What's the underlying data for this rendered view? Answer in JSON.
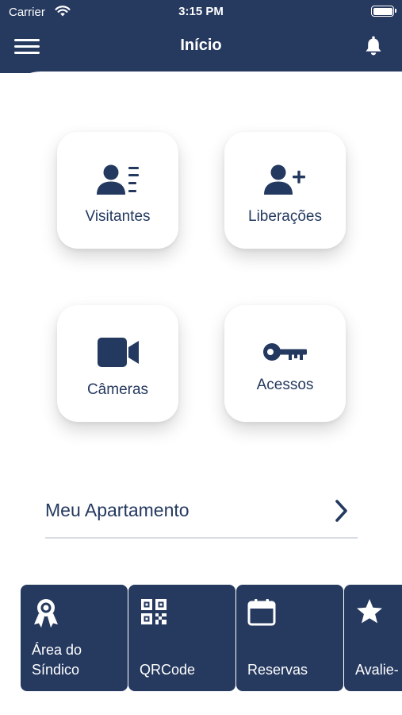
{
  "status_bar": {
    "carrier": "Carrier",
    "time": "3:15 PM"
  },
  "header": {
    "title": "Início"
  },
  "tiles": [
    {
      "label": "Visitantes",
      "icon": "contact-card-icon"
    },
    {
      "label": "Liberações",
      "icon": "user-plus-icon"
    },
    {
      "label": "Câmeras",
      "icon": "video-camera-icon"
    },
    {
      "label": "Acessos",
      "icon": "key-icon"
    }
  ],
  "apartment": {
    "label": "Meu Apartamento"
  },
  "shortcuts": [
    {
      "label": "Área do\nSíndico",
      "icon": "award-badge-icon"
    },
    {
      "label": "QRCode",
      "icon": "qrcode-icon"
    },
    {
      "label": "Reservas",
      "icon": "calendar-icon"
    },
    {
      "label": "Avalie-",
      "icon": "star-icon"
    }
  ],
  "colors": {
    "primary": "#26395f",
    "background": "#ffffff",
    "divider": "#d7dbe2"
  }
}
